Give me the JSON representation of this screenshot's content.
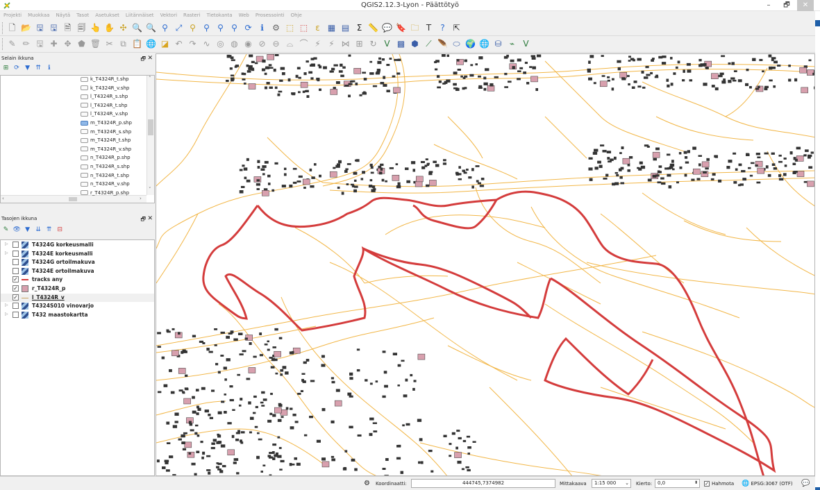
{
  "window": {
    "title": "QGIS2.12.3-Lyon - Päättötyö",
    "minimize": "–",
    "maximize": "🗗",
    "close": "✕"
  },
  "menu": [
    "Projekti",
    "Muokkaa",
    "Näytä",
    "Tasot",
    "Asetukset",
    "Liitännäiset",
    "Vektori",
    "Rasteri",
    "Tietokanta",
    "Web",
    "Prosessointi",
    "Ohje"
  ],
  "toolbar1_icons": [
    {
      "name": "new-project-icon",
      "glyph": "🗋",
      "color": "#555"
    },
    {
      "name": "open-project-icon",
      "glyph": "📂",
      "color": "#d9a520"
    },
    {
      "name": "save-project-icon",
      "glyph": "🖫",
      "color": "#3a5ea8"
    },
    {
      "name": "save-as-icon",
      "glyph": "🖫",
      "color": "#3a5ea8"
    },
    {
      "name": "new-print-composer-icon",
      "glyph": "🗎",
      "color": "#555"
    },
    {
      "name": "composer-manager-icon",
      "glyph": "🗐",
      "color": "#555"
    },
    {
      "name": "touch-icon",
      "glyph": "👆",
      "color": "#2a6ad0"
    },
    {
      "name": "pan-icon",
      "glyph": "✋",
      "color": "#444"
    },
    {
      "name": "pan-to-selection-icon",
      "glyph": "✣",
      "color": "#c9a020"
    },
    {
      "name": "zoom-in-icon",
      "glyph": "🔍",
      "color": "#2a6ad0"
    },
    {
      "name": "zoom-out-icon",
      "glyph": "🔍",
      "color": "#2a6ad0"
    },
    {
      "name": "zoom-actual-icon",
      "glyph": "⚲",
      "color": "#2a6ad0"
    },
    {
      "name": "zoom-full-icon",
      "glyph": "⤢",
      "color": "#2a6ad0"
    },
    {
      "name": "zoom-selection-icon",
      "glyph": "⚲",
      "color": "#c9a020"
    },
    {
      "name": "zoom-layer-icon",
      "glyph": "⚲",
      "color": "#2a6ad0"
    },
    {
      "name": "zoom-last-icon",
      "glyph": "⚲",
      "color": "#2a6ad0"
    },
    {
      "name": "zoom-next-icon",
      "glyph": "⚲",
      "color": "#2a6ad0"
    },
    {
      "name": "refresh-icon",
      "glyph": "⟳",
      "color": "#2a6ad0"
    },
    {
      "name": "identify-icon",
      "glyph": "ℹ",
      "color": "#2a6ad0"
    },
    {
      "name": "action-icon",
      "glyph": "⚙",
      "color": "#666"
    },
    {
      "name": "select-features-icon",
      "glyph": "⬚",
      "color": "#c9a020"
    },
    {
      "name": "deselect-icon",
      "glyph": "⬚",
      "color": "#d43c3c"
    },
    {
      "name": "select-by-expression-icon",
      "glyph": "ε",
      "color": "#c9a020"
    },
    {
      "name": "attribute-table-icon",
      "glyph": "▦",
      "color": "#3a5ea8"
    },
    {
      "name": "field-calculator-icon",
      "glyph": "▤",
      "color": "#3a5ea8"
    },
    {
      "name": "statistics-icon",
      "glyph": "Σ",
      "color": "#222"
    },
    {
      "name": "measure-icon",
      "glyph": "📏",
      "color": "#666"
    },
    {
      "name": "map-tips-icon",
      "glyph": "💬",
      "color": "#d9c020"
    },
    {
      "name": "bookmark-icon",
      "glyph": "🔖",
      "color": "#c9a020"
    },
    {
      "name": "new-bookmark-icon",
      "glyph": "🗀",
      "color": "#c9a020"
    },
    {
      "name": "annotation-icon",
      "glyph": "T",
      "color": "#333"
    },
    {
      "name": "help-icon",
      "glyph": "?",
      "color": "#2a6ad0"
    },
    {
      "name": "whats-this-icon",
      "glyph": "⇱",
      "color": "#333"
    }
  ],
  "toolbar2_icons": [
    {
      "name": "current-edits-icon",
      "glyph": "✎",
      "color": "#999"
    },
    {
      "name": "toggle-editing-icon",
      "glyph": "✏",
      "color": "#999"
    },
    {
      "name": "save-edits-icon",
      "glyph": "🖫",
      "color": "#999"
    },
    {
      "name": "add-feature-icon",
      "glyph": "✚",
      "color": "#999"
    },
    {
      "name": "move-feature-icon",
      "glyph": "✥",
      "color": "#999"
    },
    {
      "name": "node-tool-icon",
      "glyph": "⬟",
      "color": "#999"
    },
    {
      "name": "delete-selected-icon",
      "glyph": "🗑",
      "color": "#999"
    },
    {
      "name": "cut-features-icon",
      "glyph": "✂",
      "color": "#999"
    },
    {
      "name": "copy-features-icon",
      "glyph": "⧉",
      "color": "#999"
    },
    {
      "name": "paste-features-icon",
      "glyph": "📋",
      "color": "#999"
    },
    {
      "name": "osm-icon",
      "glyph": "🌐",
      "color": "#2b7a3a"
    },
    {
      "name": "digitize-icon",
      "glyph": "◪",
      "color": "#d9a520"
    },
    {
      "name": "undo-icon",
      "glyph": "↶",
      "color": "#999"
    },
    {
      "name": "redo-icon",
      "glyph": "↷",
      "color": "#999"
    },
    {
      "name": "simplify-icon",
      "glyph": "∿",
      "color": "#999"
    },
    {
      "name": "add-ring-icon",
      "glyph": "◎",
      "color": "#999"
    },
    {
      "name": "add-part-icon",
      "glyph": "◍",
      "color": "#999"
    },
    {
      "name": "fill-ring-icon",
      "glyph": "◉",
      "color": "#999"
    },
    {
      "name": "delete-ring-icon",
      "glyph": "⊘",
      "color": "#999"
    },
    {
      "name": "delete-part-icon",
      "glyph": "⊖",
      "color": "#999"
    },
    {
      "name": "reshape-icon",
      "glyph": "⌓",
      "color": "#999"
    },
    {
      "name": "offset-curve-icon",
      "glyph": "⌒",
      "color": "#999"
    },
    {
      "name": "split-features-icon",
      "glyph": "⚡",
      "color": "#999"
    },
    {
      "name": "split-parts-icon",
      "glyph": "⚡",
      "color": "#999"
    },
    {
      "name": "merge-features-icon",
      "glyph": "⋈",
      "color": "#999"
    },
    {
      "name": "merge-attributes-icon",
      "glyph": "⊞",
      "color": "#999"
    },
    {
      "name": "rotate-symbol-icon",
      "glyph": "↻",
      "color": "#999"
    },
    {
      "name": "vertex-icon",
      "glyph": "V",
      "color": "#2b7a3a"
    },
    {
      "name": "raster-icon",
      "glyph": "▩",
      "color": "#3a5ea8"
    },
    {
      "name": "vector-layer-icon",
      "glyph": "⬢",
      "color": "#3a5ea8"
    },
    {
      "name": "add-delimited-icon",
      "glyph": "⟋",
      "color": "#2b7a3a"
    },
    {
      "name": "add-spatialite-icon",
      "glyph": "🪶",
      "color": "#3a5ea8"
    },
    {
      "name": "add-wms-icon",
      "glyph": "⬭",
      "color": "#3a5ea8"
    },
    {
      "name": "add-wfs-icon",
      "glyph": "🌍",
      "color": "#3a5ea8"
    },
    {
      "name": "add-wcs-icon",
      "glyph": "🌐",
      "color": "#3a5ea8"
    },
    {
      "name": "add-db-layer-icon",
      "glyph": "⛁",
      "color": "#3a5ea8"
    },
    {
      "name": "new-layer-icon",
      "glyph": "⌁",
      "color": "#2b7a3a"
    },
    {
      "name": "gps-icon",
      "glyph": "V",
      "color": "#2b7a3a"
    }
  ],
  "browser_panel": {
    "title": "Selain ikkuna",
    "items": [
      "k_T4324R_t.shp",
      "k_T4324R_v.shp",
      "l_T4324R_s.shp",
      "l_T4324R_t.shp",
      "l_T4324R_v.shp",
      "m_T4324R_p.shp",
      "m_T4324R_s.shp",
      "m_T4324R_t.shp",
      "m_T4324R_v.shp",
      "n_T4324R_p.shp",
      "n_T4324R_s.shp",
      "n_T4324R_t.shp",
      "n_T4324R_v.shp",
      "r_T4324R_p.shp"
    ],
    "selected_index": 5
  },
  "layers_panel": {
    "title": "Tasojen ikkuna",
    "layers": [
      {
        "name": "T4324G korkeusmalli",
        "checked": false,
        "expandable": true,
        "symbol": "raster"
      },
      {
        "name": "T4324E korkeusmalli",
        "checked": false,
        "expandable": true,
        "symbol": "raster"
      },
      {
        "name": "T4324G ortoilmakuva",
        "checked": false,
        "expandable": false,
        "symbol": "raster"
      },
      {
        "name": "T4324E ortoilmakuva",
        "checked": false,
        "expandable": false,
        "symbol": "raster"
      },
      {
        "name": "tracks any",
        "checked": true,
        "expandable": false,
        "symbol": "line"
      },
      {
        "name": "r_T4324R_p",
        "checked": true,
        "expandable": false,
        "symbol": "poly"
      },
      {
        "name": "l_T4324R_v",
        "checked": true,
        "expandable": false,
        "symbol": "thin",
        "current": true
      },
      {
        "name": "T4324S010 vinovarjo",
        "checked": false,
        "expandable": true,
        "symbol": "raster"
      },
      {
        "name": "T432 maastokartta",
        "checked": false,
        "expandable": true,
        "symbol": "raster"
      }
    ]
  },
  "map_colors": {
    "roads": "#f2b646",
    "tracks": "#d43c3c",
    "buildings_fill": "#d8a0ae",
    "buildings_stroke": "#333333"
  },
  "statusbar": {
    "coord_label": "Koordinaatti:",
    "coord_value": "444745,7374982",
    "scale_label": "Mittakaava",
    "scale_value": "1:15 000",
    "rotation_label": "Kierto:",
    "rotation_value": "0,0",
    "render_label": "Hahmota",
    "render_checked": true,
    "crs_label": "EPSG:3067 (OTF)"
  }
}
